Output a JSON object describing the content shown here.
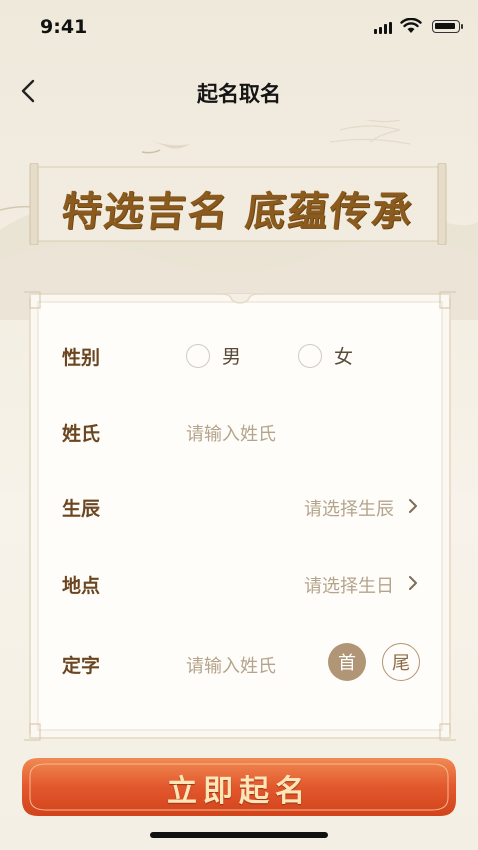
{
  "status_bar": {
    "time": "9:41"
  },
  "nav": {
    "title": "起名取名"
  },
  "banner": {
    "text": "特选吉名 底蕴传承"
  },
  "form": {
    "gender": {
      "label": "性别",
      "options": [
        "男",
        "女"
      ]
    },
    "surname": {
      "label": "姓氏",
      "placeholder": "请输入姓氏"
    },
    "birth": {
      "label": "生辰",
      "placeholder": "请选择生辰"
    },
    "place": {
      "label": "地点",
      "placeholder": "请选择生日"
    },
    "fixed_char": {
      "label": "定字",
      "placeholder": "请输入姓氏",
      "first_label": "首",
      "last_label": "尾"
    }
  },
  "cta": {
    "label": "立即起名"
  },
  "colors": {
    "accent": "#b09577",
    "label": "#6b4620",
    "cta": "#e0542a",
    "placeholder": "#b4a48c"
  }
}
